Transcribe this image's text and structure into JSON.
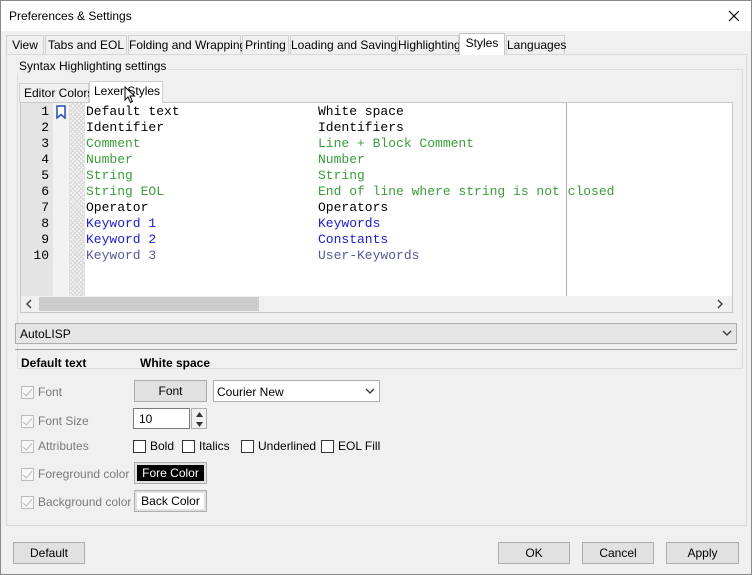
{
  "window": {
    "title": "Preferences & Settings"
  },
  "tabs": [
    "View",
    "Tabs and EOL",
    "Folding and Wrapping",
    "Printing",
    "Loading and Saving",
    "Highlighting",
    "Styles",
    "Languages"
  ],
  "group": {
    "label": "Syntax Highlighting settings"
  },
  "inner_tabs": [
    "Editor Colors",
    "Lexer Styles"
  ],
  "editor": {
    "lines": [
      {
        "n": "1",
        "left": "Default text",
        "right": "White space",
        "color": "#000000"
      },
      {
        "n": "2",
        "left": "Identifier",
        "right": "Identifiers",
        "color": "#000000"
      },
      {
        "n": "3",
        "left": "Comment",
        "right": "Line + Block Comment",
        "color": "#3a9e3a"
      },
      {
        "n": "4",
        "left": "Number",
        "right": "Number",
        "color": "#3a9e3a"
      },
      {
        "n": "5",
        "left": "String",
        "right": "String",
        "color": "#3a9e3a"
      },
      {
        "n": "6",
        "left": "String EOL",
        "right": "End of line where string is not closed",
        "color": "#3a9e3a"
      },
      {
        "n": "7",
        "left": "Operator",
        "right": "Operators",
        "color": "#000000"
      },
      {
        "n": "8",
        "left": "Keyword 1",
        "right": "Keywords",
        "color": "#2020c8"
      },
      {
        "n": "9",
        "left": "Keyword 2",
        "right": "Constants",
        "color": "#2020c8"
      },
      {
        "n": "10",
        "left": "Keyword 3",
        "right": "User-Keywords",
        "color": "#5a5a9a"
      }
    ]
  },
  "language_select": {
    "value": "AutoLISP"
  },
  "style": {
    "name": "Default text",
    "description": "White space",
    "font_label": "Font",
    "font_button": "Font",
    "font_value": "Courier New",
    "size_label": "Font Size",
    "size_value": "10",
    "attributes_label": "Attributes",
    "bold": "Bold",
    "italics": "Italics",
    "underlined": "Underlined",
    "eol_fill": "EOL Fill",
    "fg_label": "Foreground color",
    "fg_button": "Fore Color",
    "bg_label": "Background color",
    "bg_button": "Back Color"
  },
  "footer": {
    "default": "Default",
    "ok": "OK",
    "cancel": "Cancel",
    "apply": "Apply"
  },
  "colors": {
    "green": "#3a9e3a",
    "blue": "#2020c8",
    "gray_blue": "#5a5a9a"
  }
}
